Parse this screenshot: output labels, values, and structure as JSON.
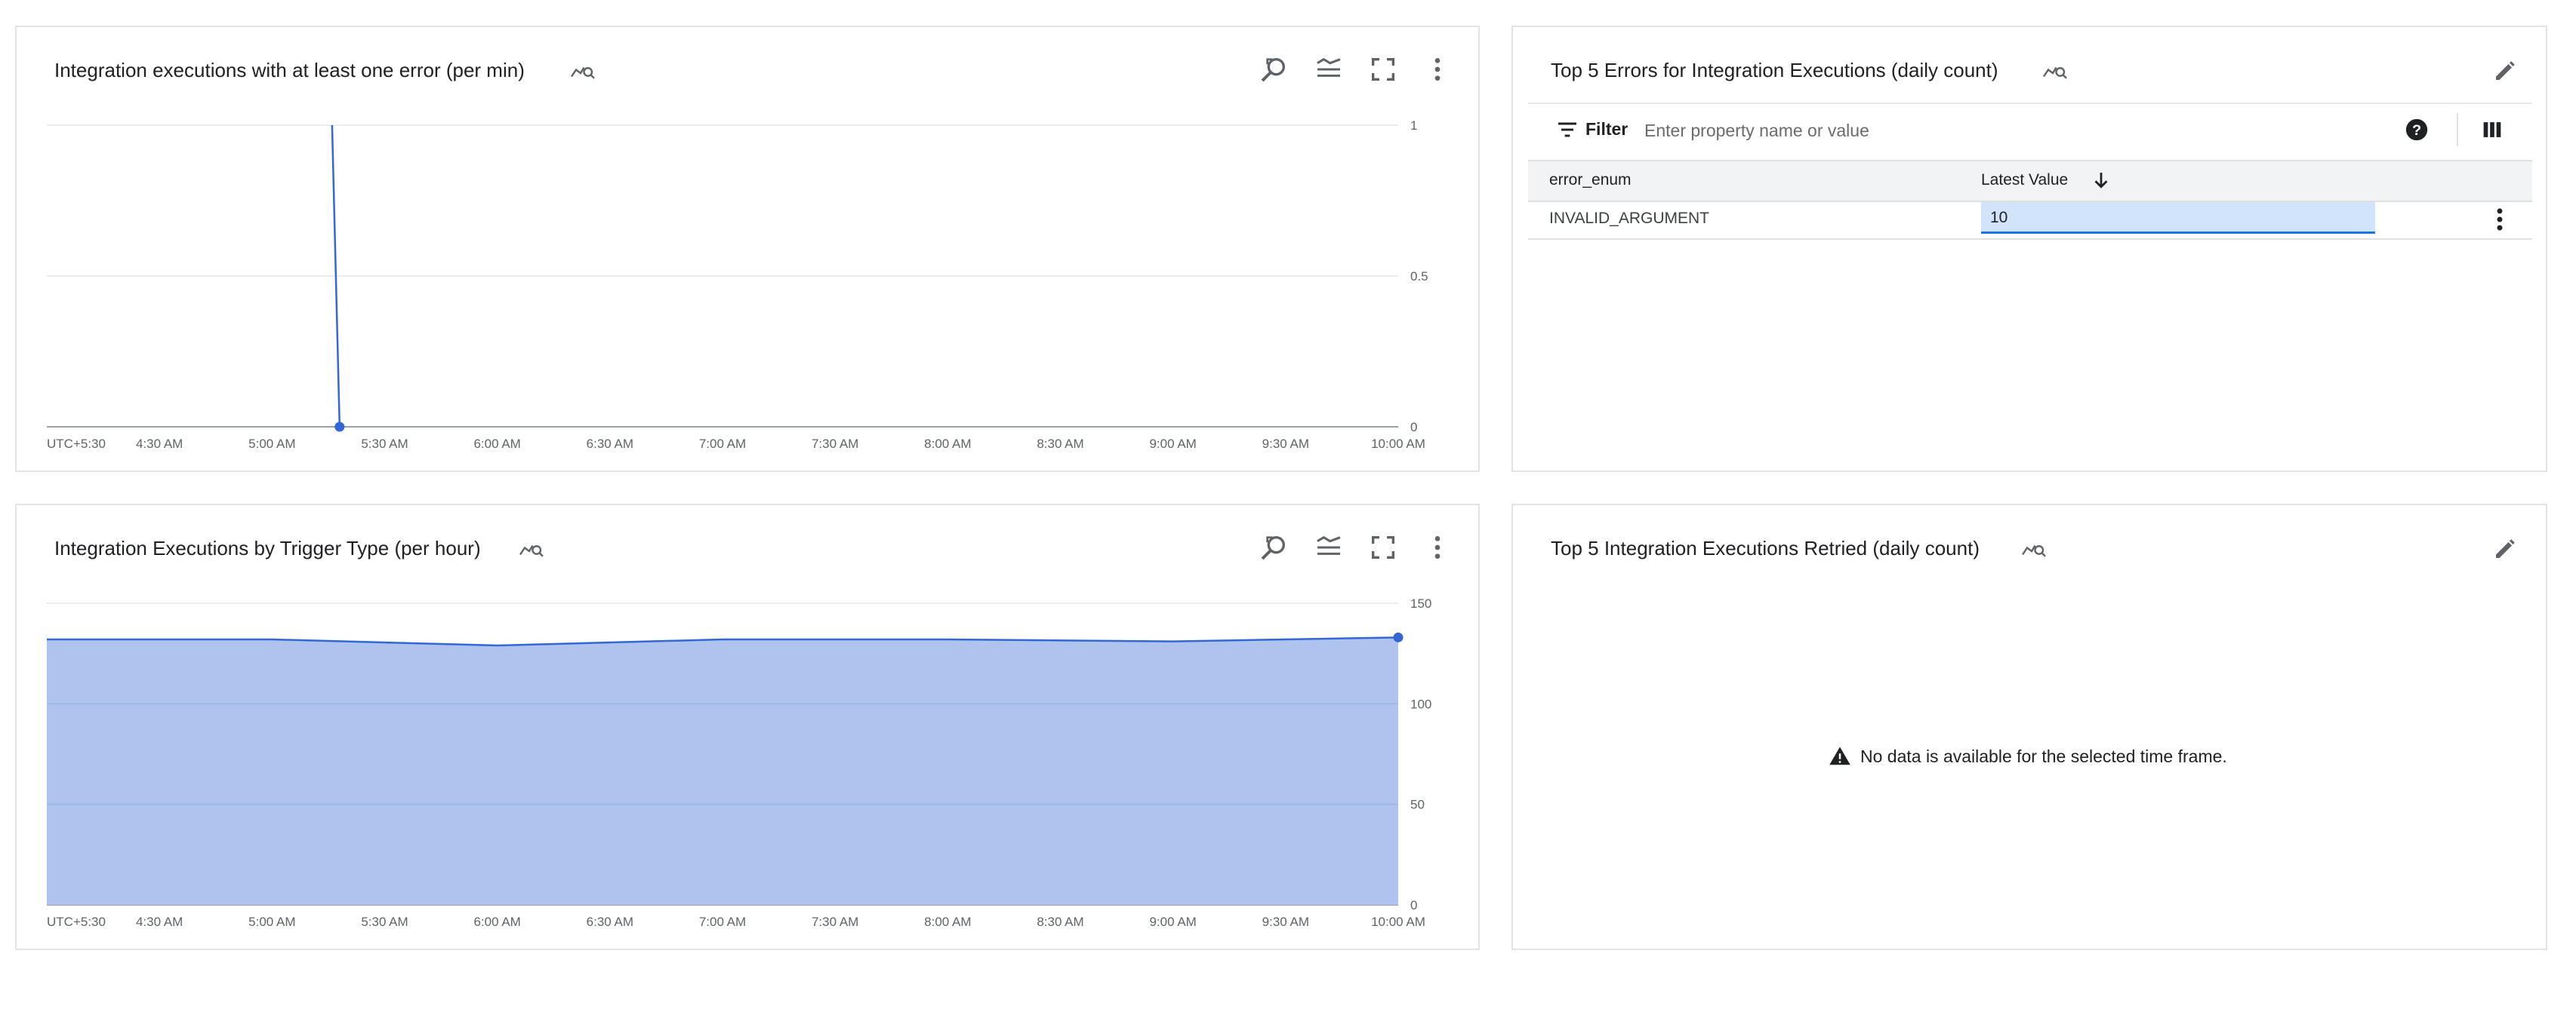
{
  "panels": {
    "errors_chart": {
      "title": "Integration executions with at least one error (per min)"
    },
    "trigger_chart": {
      "title": "Integration Executions by Trigger Type (per hour)"
    },
    "top_errors": {
      "title": "Top 5 Errors for Integration Executions (daily count)",
      "filter_label": "Filter",
      "filter_placeholder": "Enter property name or value",
      "columns": [
        "error_enum",
        "Latest Value"
      ],
      "rows": [
        {
          "error_enum": "INVALID_ARGUMENT",
          "latest_value": "10"
        }
      ]
    },
    "top_retried": {
      "title": "Top 5 Integration Executions Retried (daily count)",
      "empty_message": "No data is available for the selected time frame."
    }
  },
  "icons": {
    "chart_toggle": "query-stats-icon",
    "zoom": "zoom-icon",
    "legend": "legend-toggle-icon",
    "fullscreen": "fullscreen-icon",
    "more": "more-vert-icon",
    "edit": "edit-icon",
    "filter": "filter-icon",
    "help": "help-icon",
    "columns": "column-selector-icon",
    "sort": "arrow-downward-icon",
    "warning": "warning-icon"
  },
  "colors": {
    "series": "#3367d6",
    "area_fill": "#aec3ee",
    "highlight": "#d2e3fc",
    "accent": "#1a73e8"
  },
  "chart_data": [
    {
      "type": "line",
      "title": "Integration executions with at least one error (per min)",
      "x_tick_labels": [
        "UTC+5:30",
        "4:30 AM",
        "5:00 AM",
        "5:30 AM",
        "6:00 AM",
        "6:30 AM",
        "7:00 AM",
        "7:30 AM",
        "8:00 AM",
        "8:30 AM",
        "9:00 AM",
        "9:30 AM",
        "10:00 AM"
      ],
      "y_tick_labels": [
        "1",
        "0.5",
        "0"
      ],
      "ylim": [
        0,
        1
      ],
      "y_axis_side": "right",
      "grid": true,
      "series": [
        {
          "points": [
            [
              "5:16 AM",
              1
            ],
            [
              "5:18 AM",
              0
            ]
          ]
        }
      ]
    },
    {
      "type": "area",
      "title": "Integration Executions by Trigger Type (per hour)",
      "x_tick_labels": [
        "UTC+5:30",
        "4:30 AM",
        "5:00 AM",
        "5:30 AM",
        "6:00 AM",
        "6:30 AM",
        "7:00 AM",
        "7:30 AM",
        "8:00 AM",
        "8:30 AM",
        "9:00 AM",
        "9:30 AM",
        "10:00 AM"
      ],
      "y_tick_labels": [
        "150",
        "100",
        "50",
        "0"
      ],
      "ylim": [
        0,
        150
      ],
      "y_axis_side": "right",
      "grid": true,
      "series": [
        {
          "points": [
            [
              "4:00 AM",
              132
            ],
            [
              "5:00 AM",
              132
            ],
            [
              "6:00 AM",
              129
            ],
            [
              "7:00 AM",
              132
            ],
            [
              "8:00 AM",
              132
            ],
            [
              "9:00 AM",
              131
            ],
            [
              "10:00 AM",
              133
            ]
          ]
        }
      ]
    }
  ]
}
